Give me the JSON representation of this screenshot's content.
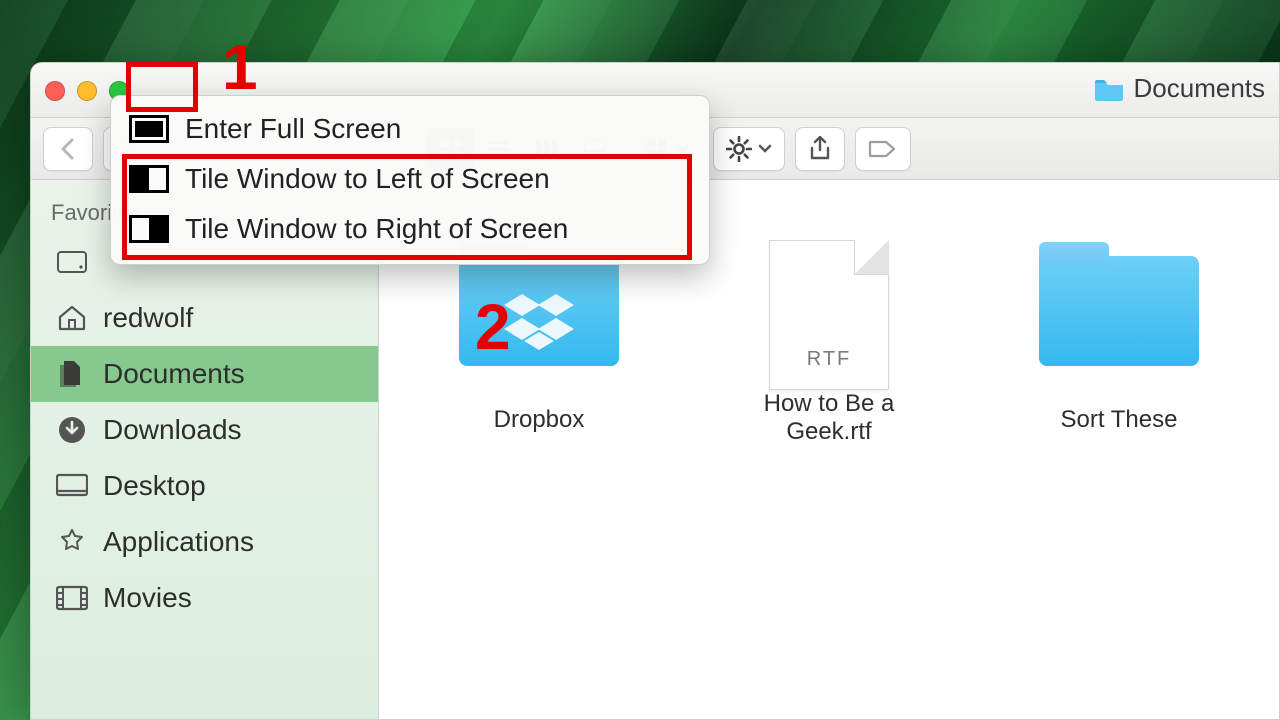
{
  "window": {
    "title": "Documents"
  },
  "sidebar": {
    "header": "Favorites",
    "items": [
      {
        "label": ""
      },
      {
        "label": "redwolf"
      },
      {
        "label": "Documents"
      },
      {
        "label": "Downloads"
      },
      {
        "label": "Desktop"
      },
      {
        "label": "Applications"
      },
      {
        "label": "Movies"
      }
    ],
    "selected_index": 2
  },
  "menu": {
    "items": [
      {
        "label": "Enter Full Screen"
      },
      {
        "label": "Tile Window to Left of Screen"
      },
      {
        "label": "Tile Window to Right of Screen"
      }
    ]
  },
  "files": [
    {
      "name": "Dropbox",
      "kind": "folder-dropbox"
    },
    {
      "name": "How to Be a Geek.rtf",
      "kind": "rtf",
      "badge": "RTF"
    },
    {
      "name": "Sort These",
      "kind": "folder"
    }
  ],
  "annotations": {
    "one": "1",
    "two": "2"
  }
}
